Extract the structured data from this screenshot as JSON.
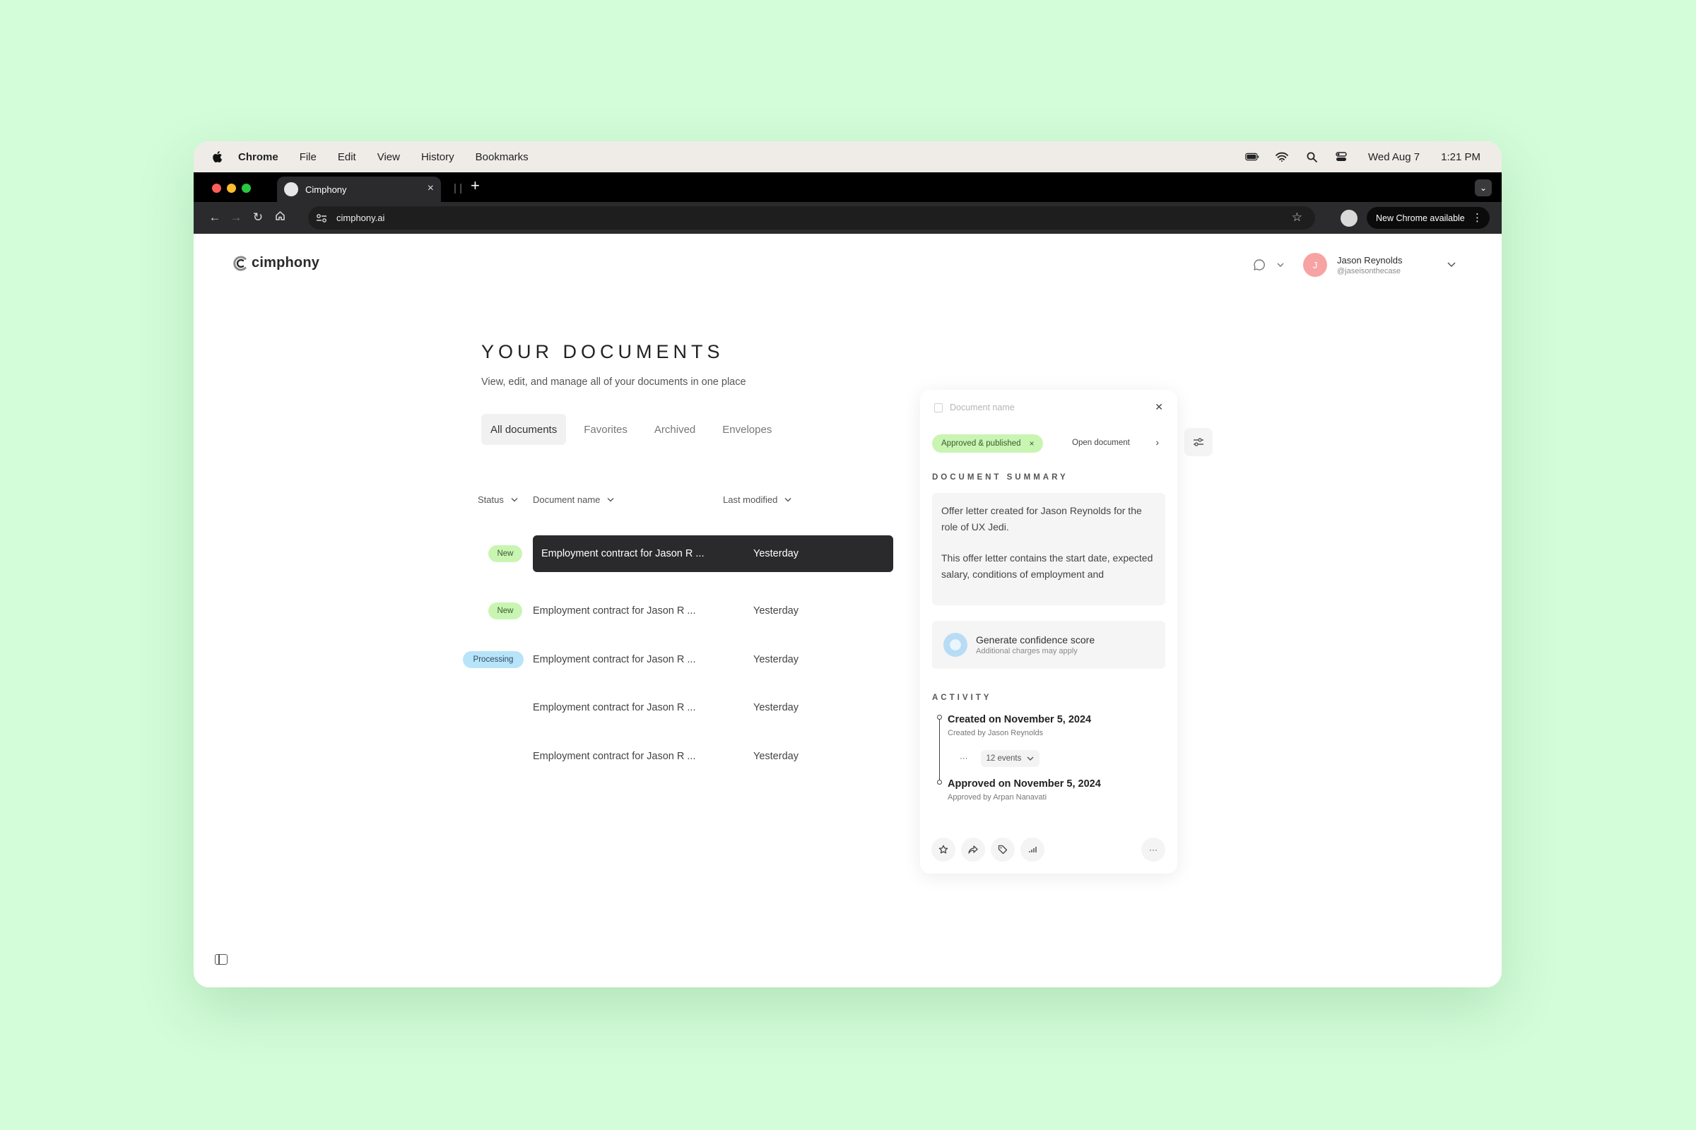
{
  "menubar": {
    "app": "Chrome",
    "items": [
      "File",
      "Edit",
      "View",
      "History",
      "Bookmarks"
    ],
    "date": "Wed Aug 7",
    "time": "1:21 PM"
  },
  "browser": {
    "tab_title": "Cimphony",
    "url": "cimphony.ai",
    "update_button": "New Chrome available"
  },
  "app": {
    "logo": "cimphony",
    "user": {
      "initial": "J",
      "name": "Jason Reynolds",
      "handle": "@jaseisonthecase"
    }
  },
  "page": {
    "title": "YOUR DOCUMENTS",
    "subtitle": "View, edit, and manage all of your documents in one place",
    "tabs": [
      "All documents",
      "Favorites",
      "Archived",
      "Envelopes"
    ],
    "active_tab": "All documents",
    "columns": {
      "status": "Status",
      "name": "Document name",
      "modified": "Last modified"
    },
    "rows": [
      {
        "status": "New",
        "name": "Employment contract for Jason R ...",
        "modified": "Yesterday",
        "selected": true
      },
      {
        "status": "New",
        "name": "Employment contract for Jason R ...",
        "modified": "Yesterday"
      },
      {
        "status": "Processing",
        "name": "Employment contract for Jason R ...",
        "modified": "Yesterday"
      },
      {
        "status": "",
        "name": "Employment contract for Jason R ...",
        "modified": "Yesterday"
      },
      {
        "status": "",
        "name": "Employment contract for Jason R ...",
        "modified": "Yesterday"
      }
    ]
  },
  "panel": {
    "doc_name_placeholder": "Document name",
    "status_chip": "Approved & published",
    "open_document": "Open document",
    "summary_label": "DOCUMENT SUMMARY",
    "summary_p1": "Offer letter created for Jason Reynolds for the role of UX Jedi.",
    "summary_p2": "This offer letter contains the start date, expected salary, conditions of employment and",
    "confidence_title": "Generate confidence score",
    "confidence_sub": "Additional charges may apply",
    "activity_label": "ACTIVITY",
    "created_title": "Created on November 5, 2024",
    "created_by": "Created by Jason Reynolds",
    "events_more": "···",
    "events_count": "12 events",
    "approved_title": "Approved on November 5, 2024",
    "approved_by": "Approved by Arpan Nanavati",
    "more": "···"
  },
  "colors": {
    "background": "#d3fcd8",
    "new_badge": "#c9f5b3",
    "processing_badge": "#b8e4fa",
    "avatar": "#f7a3a3"
  }
}
